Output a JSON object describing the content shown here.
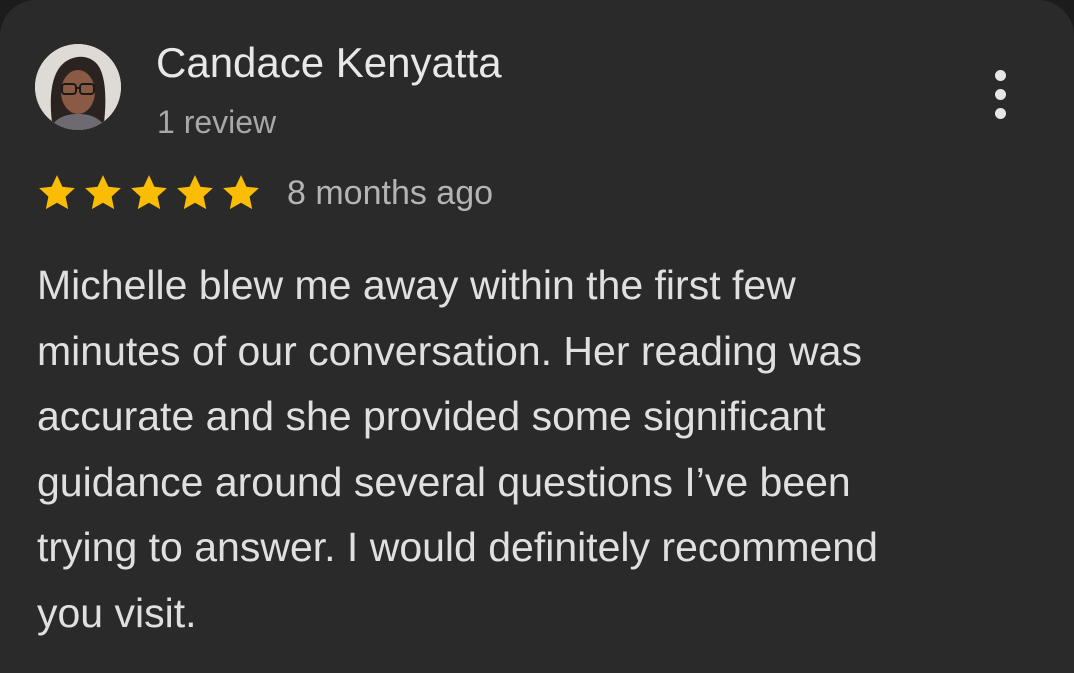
{
  "review": {
    "author_name": "Candace Kenyatta",
    "author_review_count": "1 review",
    "rating": 5,
    "rating_max": 5,
    "time_ago": "8 months ago",
    "text_lines": [
      "Michelle blew me away within the first few",
      "minutes of our conversation. Her reading was",
      "accurate and she provided some significant",
      "guidance around several questions I’ve been",
      "trying to answer. I would definitely recommend",
      "you visit."
    ]
  },
  "icons": {
    "more": "more-vert-icon",
    "star": "star-icon"
  },
  "colors": {
    "card_background": "#2a2a2a",
    "star": "#fbbc04",
    "primary_text": "#e8e8e8",
    "secondary_text": "#a8a8a8"
  }
}
